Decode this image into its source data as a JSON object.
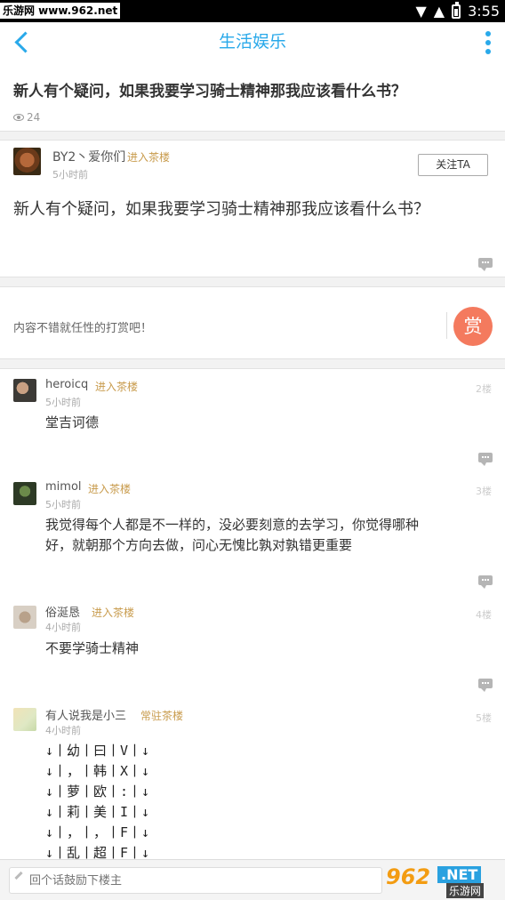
{
  "statusbar": {
    "watermark": "乐游网 www.962.net",
    "time": "3:55",
    "wifi": "▼",
    "signal": "▲"
  },
  "header": {
    "title": "生活娱乐"
  },
  "topic": {
    "title": "新人有个疑问，如果我要学习骑士精神那我应该看什么书？",
    "views": "24"
  },
  "post": {
    "username": "BY2丶爱你们",
    "tag": "进入茶楼",
    "time": "5小时前",
    "follow_label": "关注TA",
    "body": "新人有个疑问，如果我要学习骑士精神那我应该看什么书？"
  },
  "reward": {
    "text": "内容不错就任性的打赏吧！",
    "button": "赏"
  },
  "comments": [
    {
      "username": "heroicq",
      "tag": "进入茶楼",
      "time": "5小时前",
      "floor": "2楼",
      "lines": [
        "堂吉诃德"
      ]
    },
    {
      "username": "mimol",
      "tag": "进入茶楼",
      "time": "5小时前",
      "floor": "3楼",
      "lines": [
        "我觉得每个人都是不一样的，没必要刻意的去学习，你觉得哪种",
        "好，就朝那个方向去做，问心无愧比孰对孰错更重要"
      ]
    },
    {
      "username": "俗涎恳",
      "tag": "进入茶楼",
      "time": "4小时前",
      "floor": "4楼",
      "lines": [
        "不要学骑士精神"
      ]
    },
    {
      "username": "有人说我是小三",
      "tag": "常驻茶楼",
      "time": "4小时前",
      "floor": "5楼",
      "lines": [
        "↓丨幼丨曰丨V丨↓",
        "↓丨，丨韩丨X丨↓",
        "↓丨萝丨欧丨:丨↓",
        "↓丨莉丨美丨I丨↓",
        "↓丨，丨，丨F丨↓",
        "↓丨乱丨超丨F丨↓"
      ]
    }
  ],
  "bottom": {
    "placeholder": "回个话鼓励下楼主",
    "watermark_num": "962",
    "watermark_net": ".NET",
    "watermark_cn": "乐游网"
  }
}
